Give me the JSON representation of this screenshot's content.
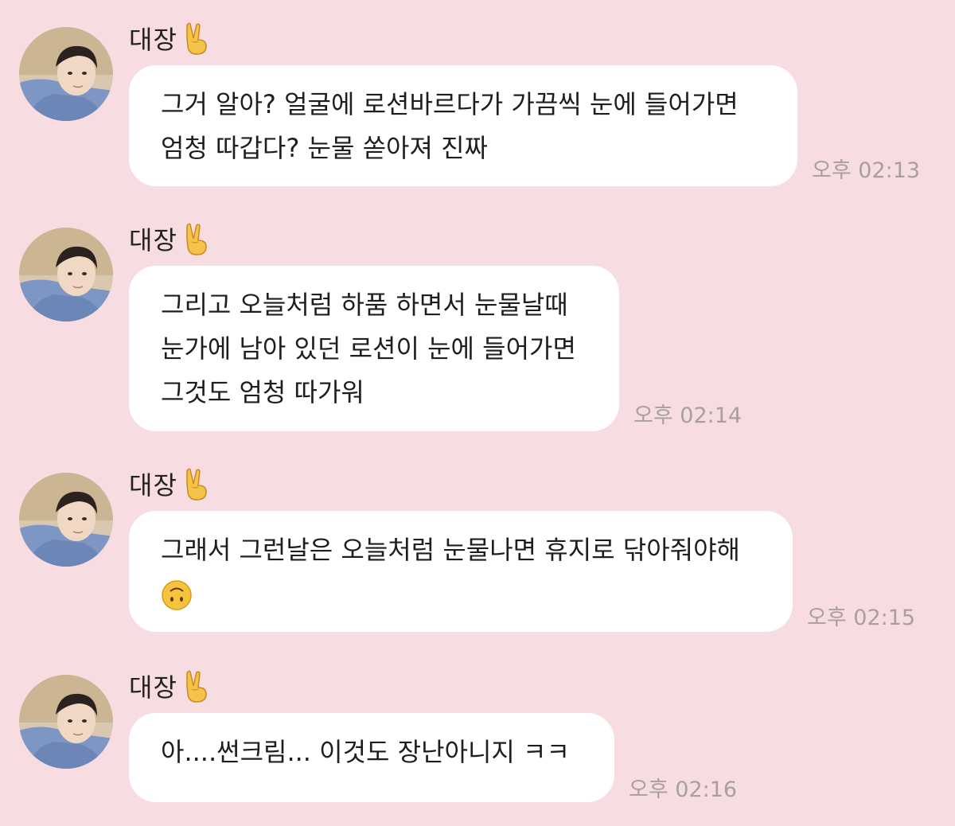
{
  "colors": {
    "background": "#f7dde2",
    "bubble": "#ffffff",
    "time_text": "#a99ea1",
    "message_text": "#1e1e1e"
  },
  "messages": [
    {
      "sender": "대장",
      "sender_icon": "victory-hand-icon",
      "lines": [
        "그거 알아? 얼굴에 로션바르다가 가끔씩 눈에 들어가면",
        "엄청 따갑다? 눈물 쏟아져 진짜"
      ],
      "time": "오후 02:13"
    },
    {
      "sender": "대장",
      "sender_icon": "victory-hand-icon",
      "lines": [
        "그리고 오늘처럼 하품 하면서 눈물날때",
        "눈가에 남아 있던 로션이 눈에 들어가면",
        "그것도 엄청 따가워"
      ],
      "time": "오후 02:14"
    },
    {
      "sender": "대장",
      "sender_icon": "victory-hand-icon",
      "lines": [
        "그래서 그런날은 오늘처럼 눈물나면 휴지로 닦아줘야해"
      ],
      "emoji": "upside-down-face-icon",
      "time": "오후 02:15"
    },
    {
      "sender": "대장",
      "sender_icon": "victory-hand-icon",
      "lines": [
        "아....썬크림... 이것도 장난아니지 ㅋㅋ"
      ],
      "time": "오후 02:16"
    }
  ]
}
